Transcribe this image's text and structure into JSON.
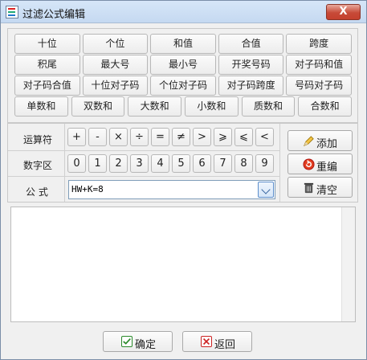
{
  "window": {
    "title": "过滤公式编辑",
    "close_label": "X"
  },
  "quick_buttons": [
    [
      "十位",
      "个位",
      "和值",
      "合值",
      "跨度"
    ],
    [
      "积尾",
      "最大号",
      "最小号",
      "开奖号码",
      "对子码和值"
    ],
    [
      "对子码合值",
      "十位对子码",
      "个位对子码",
      "对子码跨度",
      "号码对子码"
    ],
    [
      "单数和",
      "双数和",
      "大数和",
      "小数和",
      "质数和",
      "合数和"
    ]
  ],
  "operators": {
    "label": "运算符",
    "items": [
      "+",
      "-",
      "×",
      "÷",
      "=",
      "≠",
      ">",
      "⩾",
      "⩽",
      "<"
    ]
  },
  "digits": {
    "label": "数字区",
    "items": [
      "0",
      "1",
      "2",
      "3",
      "4",
      "5",
      "6",
      "7",
      "8",
      "9"
    ]
  },
  "formula": {
    "label": "公 式",
    "value": "HW+K=8"
  },
  "actions": {
    "add_label": "添加",
    "reset_label": "重编",
    "clear_label": "清空"
  },
  "footer": {
    "confirm_label": "确定",
    "back_label": "返回"
  }
}
